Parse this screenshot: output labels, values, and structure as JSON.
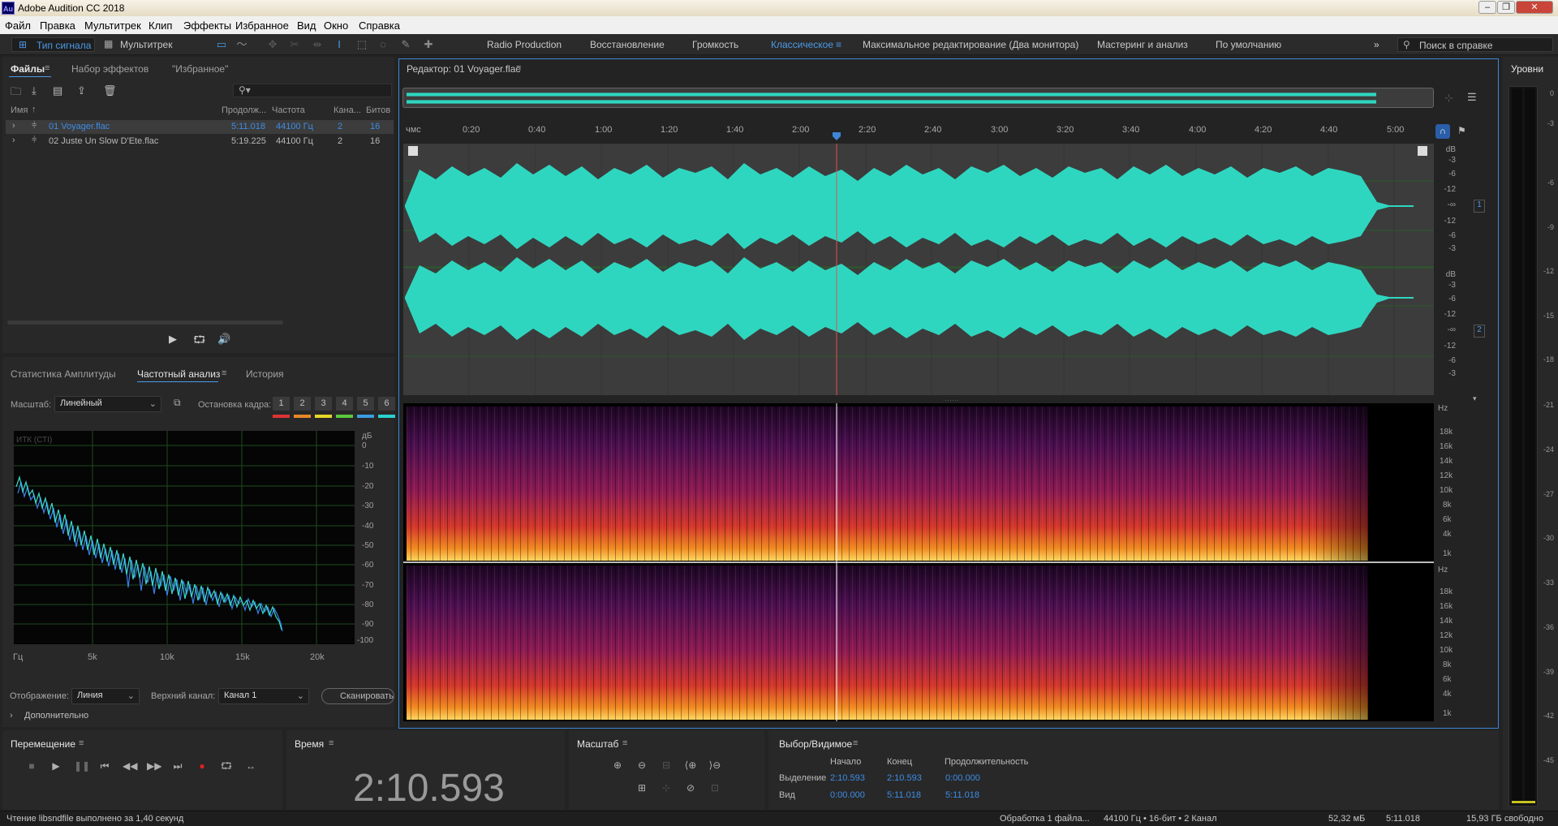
{
  "window": {
    "title": "Adobe Audition CC 2018",
    "icon": "Au"
  },
  "menu": [
    "Файл",
    "Правка",
    "Мультитрек",
    "Клип",
    "Эффекты",
    "Избранное",
    "Вид",
    "Окно",
    "Справка"
  ],
  "toolbar": {
    "waveform_label": "Тип сигнала",
    "multitrack_label": "Мультитрек"
  },
  "workspaces": [
    "Radio Production",
    "Восстановление",
    "Громкость",
    "Классическое",
    "Максимальное редактирование (Два монитора)",
    "Мастеринг и анализ",
    "По умолчанию"
  ],
  "active_workspace": "Классическое",
  "search": {
    "placeholder": "Поиск в справке"
  },
  "files_panel": {
    "tabs": [
      "Файлы",
      "Набор эффектов",
      "\"Избранное\""
    ],
    "columns": [
      "Имя",
      "Продолж...",
      "Частота",
      "Кана...",
      "Битов"
    ],
    "rows": [
      {
        "name": "01 Voyager.flac",
        "duration": "5:11.018",
        "rate": "44100 Гц",
        "channels": "2",
        "bits": "16"
      },
      {
        "name": "02 Juste Un Slow D'Ete.flac",
        "duration": "5:19.225",
        "rate": "44100 Гц",
        "channels": "2",
        "bits": "16"
      }
    ]
  },
  "analysis_panel": {
    "tabs": [
      "Статистика Амплитуды",
      "Частотный анализ",
      "История"
    ],
    "scale_label": "Масштаб:",
    "scale_value": "Линейный",
    "freeze_label": "Остановка кадра:",
    "freeze_buttons": [
      "1",
      "2",
      "3",
      "4",
      "5",
      "6"
    ],
    "graph_label": "ИТК (СТI)",
    "y_unit": "дБ",
    "y_ticks": [
      "0",
      "-10",
      "-20",
      "-30",
      "-40",
      "-50",
      "-60",
      "-70",
      "-80",
      "-90",
      "-100"
    ],
    "x_ticks": [
      "Гц",
      "5k",
      "10k",
      "15k",
      "20k"
    ],
    "display_label": "Отображение:",
    "display_value": "Линия",
    "channel_label": "Верхний канал:",
    "channel_value": "Канал 1",
    "scan_label": "Сканировать",
    "more_label": "Дополнительно"
  },
  "editor": {
    "title": "Редактор: 01 Voyager.flac",
    "ruler_unit": "чмс",
    "ruler_ticks": [
      "0:20",
      "0:40",
      "1:00",
      "1:20",
      "1:40",
      "2:00",
      "2:20",
      "2:40",
      "3:00",
      "3:20",
      "3:40",
      "4:00",
      "4:20",
      "4:40",
      "5:00"
    ],
    "db_ticks": [
      "dB",
      "-3",
      "-6",
      "-12",
      "-∞",
      "-12",
      "-6",
      "-3"
    ],
    "channel_badges": [
      "1",
      "2"
    ],
    "hz_ticks": [
      "Hz",
      "18k",
      "16k",
      "14k",
      "12k",
      "10k",
      "8k",
      "6k",
      "4k",
      "1k"
    ],
    "wave_color": "#2fd6bf"
  },
  "levels": {
    "title": "Уровни",
    "ticks": [
      "0",
      "-3",
      "-6",
      "-9",
      "-12",
      "-15",
      "-18",
      "-21",
      "-24",
      "-27",
      "-30",
      "-33",
      "-36",
      "-39",
      "-42",
      "-45"
    ]
  },
  "transport": {
    "title": "Перемещение"
  },
  "time_panel": {
    "title": "Время",
    "value": "2:10.593"
  },
  "zoom_panel": {
    "title": "Масштаб"
  },
  "selection_panel": {
    "title": "Выбор/Видимое",
    "col_start": "Начало",
    "col_end": "Конец",
    "col_duration": "Продолжительность",
    "sel_label": "Выделение",
    "sel_start": "2:10.593",
    "sel_end": "2:10.593",
    "sel_duration": "0:00.000",
    "view_label": "Вид",
    "view_start": "0:00.000",
    "view_end": "5:11.018",
    "view_duration": "5:11.018"
  },
  "statusbar": {
    "left": "Чтение libsndfile выполнено за 1,40 секунд",
    "processing": "Обработка 1 файла...",
    "format": "44100 Гц • 16-бит • 2 Канал",
    "size": "52,32 мБ",
    "duration": "5:11.018",
    "free": "15,93 ГБ свободно"
  }
}
